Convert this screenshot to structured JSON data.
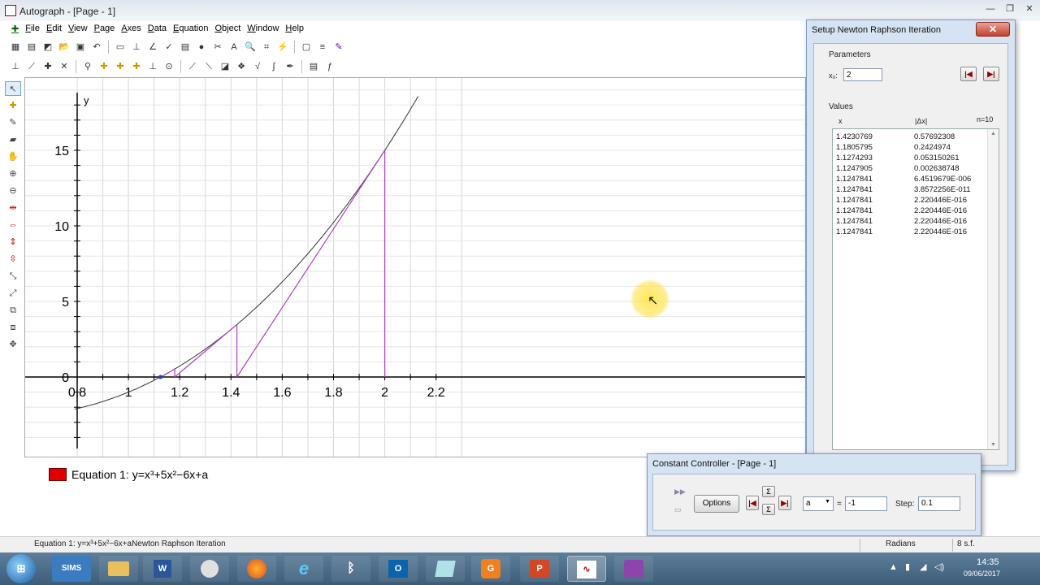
{
  "window": {
    "title": "Autograph - [Page - 1]"
  },
  "menu": [
    "File",
    "Edit",
    "View",
    "Page",
    "Axes",
    "Data",
    "Equation",
    "Object",
    "Window",
    "Help"
  ],
  "graph": {
    "y_label": "y",
    "x_ticks": [
      "0.8",
      "1",
      "1.2",
      "1.4",
      "1.6",
      "1.8",
      "2",
      "2.2"
    ],
    "y_ticks": [
      "0",
      "5",
      "10",
      "15"
    ]
  },
  "chart_data": {
    "type": "line",
    "x_range": [
      0.8,
      2.2
    ],
    "y_range": [
      -2.5,
      18
    ],
    "curve": {
      "equation": "y=x³+5x²−6x+a",
      "a": -1
    },
    "newton_steps_x": [
      2,
      1.4230769,
      1.1805795,
      1.1274293,
      1.1247905,
      1.1247841
    ]
  },
  "legend": {
    "label": "Equation 1: y=x³+5x²−6x+a",
    "color": "#e00000"
  },
  "newton_dialog": {
    "title": "Setup Newton Raphson Iteration",
    "close": "✕",
    "parameters_label": "Parameters",
    "x0_label": "x₀:",
    "x0_value": "2",
    "values_label": "Values",
    "col_x": "x",
    "col_dx": "|Δx|",
    "n_label": "n=10",
    "rows": [
      {
        "x": "1.4230769",
        "dx": "0.57692308"
      },
      {
        "x": "1.1805795",
        "dx": "0.2424974"
      },
      {
        "x": "1.1274293",
        "dx": "0.053150261"
      },
      {
        "x": "1.1247905",
        "dx": "0.002638748"
      },
      {
        "x": "1.1247841",
        "dx": "6.4519679E-006"
      },
      {
        "x": "1.1247841",
        "dx": "3.8572256E-011"
      },
      {
        "x": "1.1247841",
        "dx": "2.220446E-016"
      },
      {
        "x": "1.1247841",
        "dx": "2.220446E-016"
      },
      {
        "x": "1.1247841",
        "dx": "2.220446E-016"
      },
      {
        "x": "1.1247841",
        "dx": "2.220446E-016"
      }
    ]
  },
  "constant_controller": {
    "title": "Constant Controller - [Page - 1]",
    "options_label": "Options",
    "constant_name": "a",
    "equals": "=",
    "constant_value": "-1",
    "step_label": "Step:",
    "step_value": "0.1"
  },
  "status": {
    "message": "Equation 1: y=x³+5x²−6x+aNewton Raphson Iteration",
    "angle_mode": "Radians",
    "precision": "8 s.f."
  },
  "taskbar": {
    "start": "⊞",
    "apps": [
      "SIMS",
      "Explorer",
      "Word",
      "Paint",
      "Firefox",
      "IE",
      "Bluetooth",
      "Outlook",
      "Notes",
      "PDF",
      "PowerPoint",
      "Autograph",
      "Teams"
    ],
    "time": "14:35",
    "date": "09/06/2017"
  }
}
